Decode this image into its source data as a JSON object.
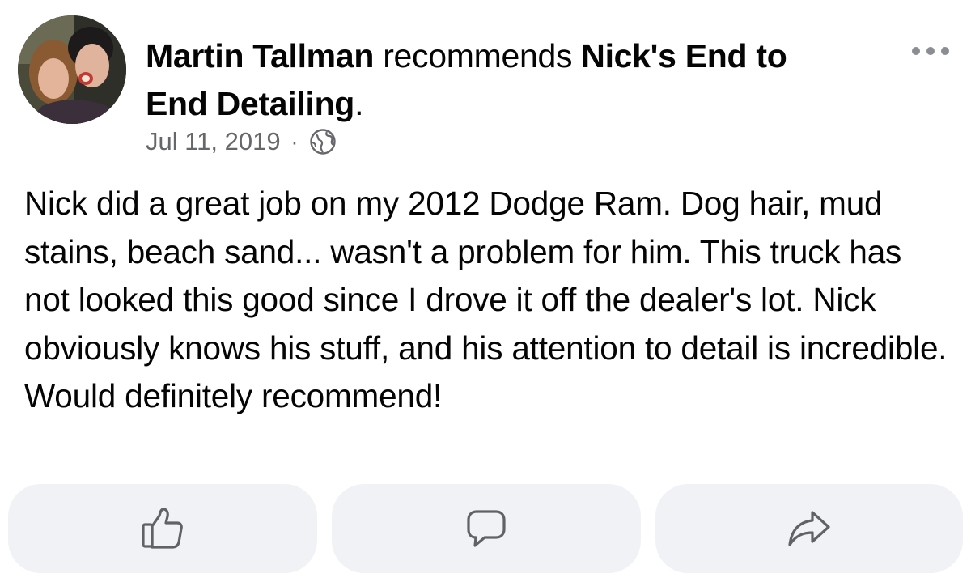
{
  "post": {
    "author": "Martin Tallman",
    "action_text": "recommends",
    "page_name": "Nick's End to End Detailing",
    "punctuation": ".",
    "date": "Jul 11, 2019",
    "separator": "·",
    "privacy_icon": "globe-icon",
    "more_icon": "more-options-icon",
    "body": "Nick did a great job on my 2012 Dodge Ram. Dog hair, mud stains, beach sand... wasn't a problem for him. This truck has not looked this good since I drove it off the dealer's lot. Nick obviously knows his stuff, and his attention to detail is incredible. Would definitely recommend!"
  },
  "actions": [
    {
      "name": "like",
      "icon": "thumbs-up-icon"
    },
    {
      "name": "comment",
      "icon": "comment-icon"
    },
    {
      "name": "share",
      "icon": "share-icon"
    }
  ],
  "colors": {
    "text": "#050505",
    "secondary_text": "#65676b",
    "button_background": "#f0f2f5"
  }
}
